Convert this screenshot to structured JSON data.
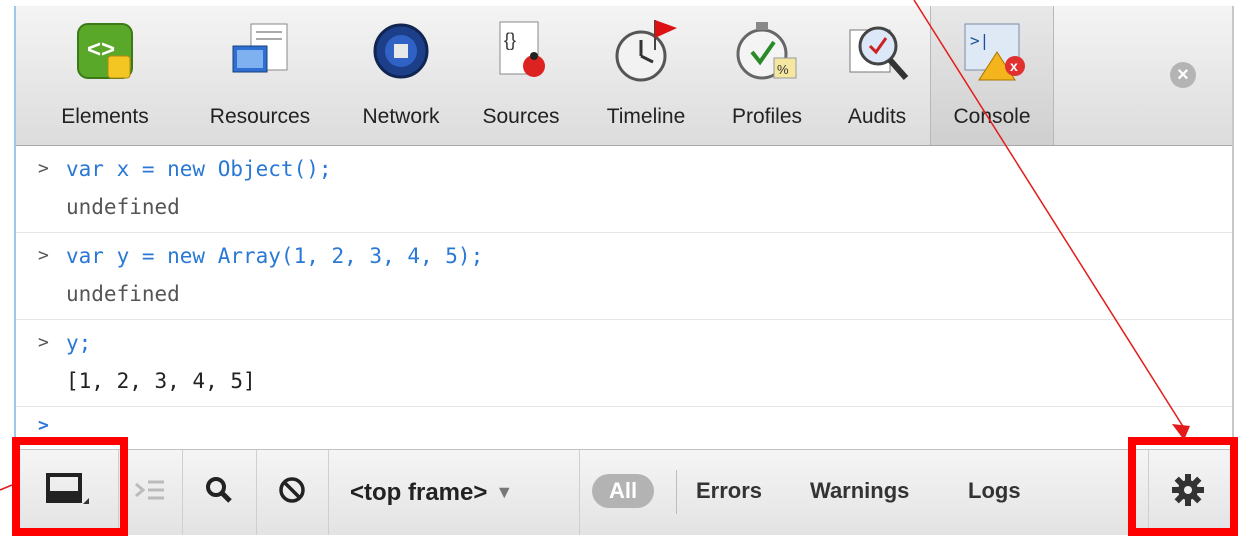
{
  "toolbar": {
    "tabs": [
      {
        "label": "Elements",
        "icon": "elements-icon"
      },
      {
        "label": "Resources",
        "icon": "resources-icon"
      },
      {
        "label": "Network",
        "icon": "network-icon"
      },
      {
        "label": "Sources",
        "icon": "sources-icon"
      },
      {
        "label": "Timeline",
        "icon": "timeline-icon"
      },
      {
        "label": "Profiles",
        "icon": "profiles-icon"
      },
      {
        "label": "Audits",
        "icon": "audits-icon"
      },
      {
        "label": "Console",
        "icon": "console-icon",
        "selected": true
      }
    ],
    "close_glyph": "×"
  },
  "console": {
    "prompt_glyph": ">",
    "entries": [
      {
        "input": "var x = new Object();",
        "output": "undefined"
      },
      {
        "input": "var y = new Array(1, 2, 3, 4, 5);",
        "output": "undefined"
      },
      {
        "input": "y;",
        "output": "[1, 2, 3, 4, 5]"
      }
    ]
  },
  "statusbar": {
    "frame_select": "<top frame>",
    "dropdown_glyph": "▼",
    "filter_all": "All",
    "filters": [
      "Errors",
      "Warnings",
      "Logs"
    ]
  },
  "colors": {
    "annotation_red": "#ff0000",
    "console_input_blue": "#2a78d6"
  }
}
